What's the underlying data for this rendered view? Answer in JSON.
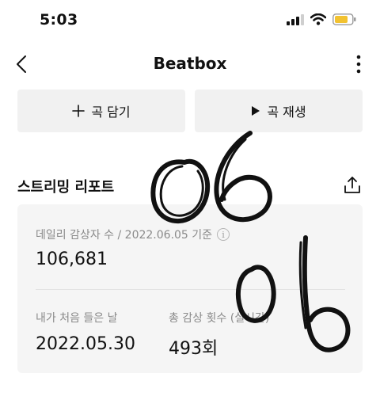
{
  "status_bar": {
    "time": "5:03",
    "icons": [
      "cellular-signal-icon",
      "wifi-icon",
      "battery-icon"
    ],
    "battery_color": "#f2c230"
  },
  "nav": {
    "title": "Beatbox",
    "back_icon": "chevron-left-icon",
    "more_icon": "more-vertical-icon"
  },
  "actions": {
    "add_label": "곡 담기",
    "play_label": "곡 재생"
  },
  "report": {
    "title": "스트리밍 리포트",
    "daily_listeners_label": "데일리 감상자 수 / 2022.06.05 기준",
    "daily_listeners_value": "106,681",
    "first_listened_label": "내가 처음 들은 날",
    "first_listened_value": "2022.05.30",
    "total_plays_label": "총 감상 횟수 (실시간)",
    "total_plays_value": "493회"
  },
  "handwriting": {
    "large_text": "06",
    "small_text": "06",
    "ink_color": "#111111"
  }
}
